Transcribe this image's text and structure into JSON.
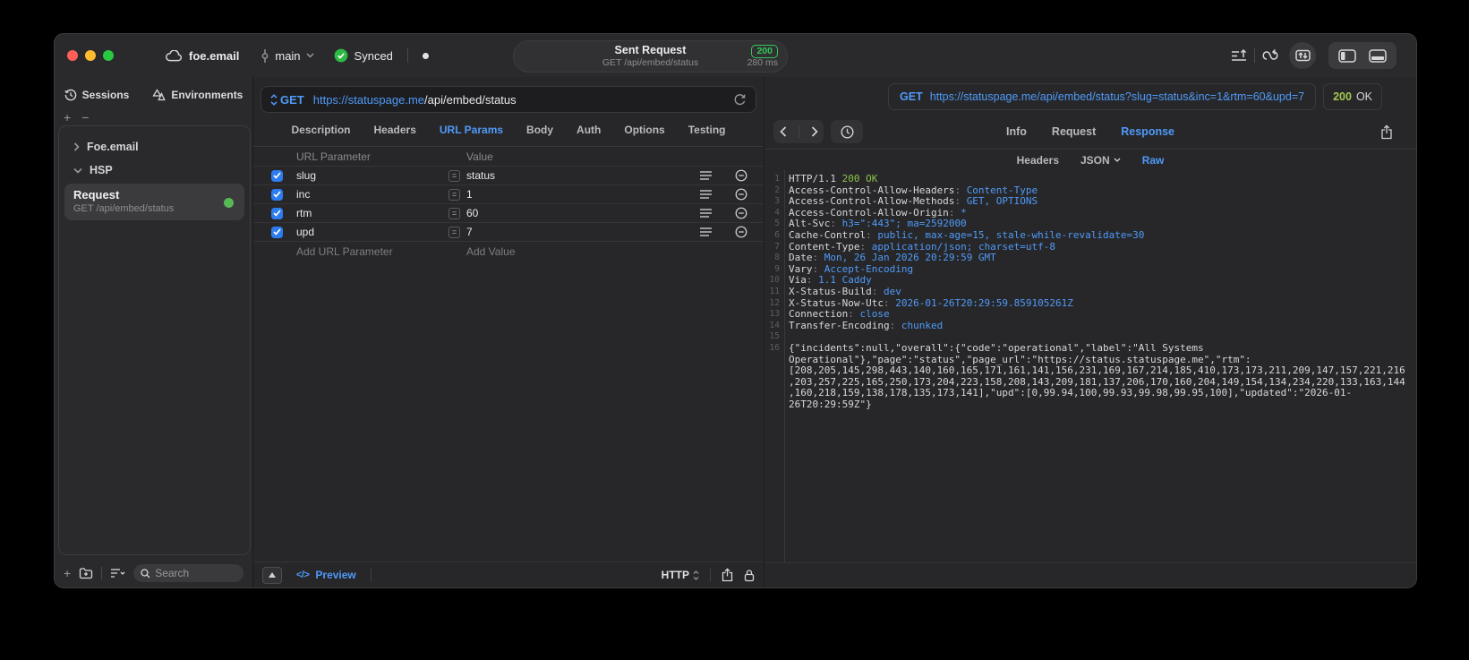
{
  "titlebar": {
    "project": "foe.email",
    "branch": "main",
    "sync_label": "Synced",
    "center": {
      "title": "Sent Request",
      "status_code": "200",
      "subtitle": "GET /api/embed/status",
      "duration": "280 ms"
    }
  },
  "sidebar": {
    "tabs": [
      "Sessions",
      "Environments"
    ],
    "tree": [
      {
        "label": "Foe.email",
        "state": "collapsed"
      },
      {
        "label": "HSP",
        "state": "expanded"
      }
    ],
    "request_item": {
      "title": "Request",
      "subtitle": "GET /api/embed/status"
    },
    "search_placeholder": "Search"
  },
  "request_pane": {
    "method": "GET",
    "url_host": "https://statuspage.me",
    "url_path": "/api/embed/status",
    "tabs": [
      "Description",
      "Headers",
      "URL Params",
      "Body",
      "Auth",
      "Options",
      "Testing"
    ],
    "active_tab": "URL Params",
    "params_table": {
      "columns": [
        "URL Parameter",
        "Value"
      ],
      "eq_symbol": "=",
      "rows": [
        {
          "name": "slug",
          "value": "status",
          "enabled": true
        },
        {
          "name": "inc",
          "value": "1",
          "enabled": true
        },
        {
          "name": "rtm",
          "value": "60",
          "enabled": true
        },
        {
          "name": "upd",
          "value": "7",
          "enabled": true
        }
      ],
      "add_name_placeholder": "Add URL Parameter",
      "add_value_placeholder": "Add Value"
    },
    "footer": {
      "preview_icon": "</>",
      "preview_label": "Preview",
      "protocol": "HTTP"
    }
  },
  "response_pane": {
    "request_line": {
      "method": "GET",
      "url": "https://statuspage.me/api/embed/status?slug=status&inc=1&rtm=60&upd=7"
    },
    "status": {
      "code": "200",
      "text": "OK"
    },
    "tabs": [
      "Info",
      "Request",
      "Response"
    ],
    "active_tab": "Response",
    "subtabs": [
      "Headers",
      "JSON",
      "Raw"
    ],
    "active_subtab": "Raw",
    "code": {
      "status_protocol": "HTTP/1.1",
      "status_text": "200 OK",
      "headers": [
        {
          "name": "Access-Control-Allow-Headers",
          "value": "Content-Type"
        },
        {
          "name": "Access-Control-Allow-Methods",
          "value": "GET, OPTIONS"
        },
        {
          "name": "Access-Control-Allow-Origin",
          "value": "*"
        },
        {
          "name": "Alt-Svc",
          "value": "h3=\":443\"; ma=2592000"
        },
        {
          "name": "Cache-Control",
          "value": "public, max-age=15, stale-while-revalidate=30"
        },
        {
          "name": "Content-Type",
          "value": "application/json; charset=utf-8"
        },
        {
          "name": "Date",
          "value": "Mon, 26 Jan 2026 20:29:59 GMT"
        },
        {
          "name": "Vary",
          "value": "Accept-Encoding"
        },
        {
          "name": "Via",
          "value": "1.1 Caddy"
        },
        {
          "name": "X-Status-Build",
          "value": "dev"
        },
        {
          "name": "X-Status-Now-Utc",
          "value": "2026-01-26T20:29:59.859105261Z"
        },
        {
          "name": "Connection",
          "value": "close"
        },
        {
          "name": "Transfer-Encoding",
          "value": "chunked"
        }
      ],
      "body": "{\"incidents\":null,\"overall\":{\"code\":\"operational\",\"label\":\"All Systems Operational\"},\"page\":\"status\",\"page_url\":\"https://status.statuspage.me\",\"rtm\":[208,205,145,298,443,140,160,165,171,161,141,156,231,169,167,214,185,410,173,173,211,209,147,157,221,216,203,257,225,165,250,173,204,223,158,208,143,209,181,137,206,170,160,204,149,154,134,234,220,133,163,144,160,218,159,138,178,135,173,141],\"upd\":[0,99.94,100,99.93,99.98,99.95,100],\"updated\":\"2026-01-26T20:29:59Z\"}"
    }
  },
  "colors": {
    "accent_blue": "#4f9af8",
    "badge_green": "#32c759",
    "code_green": "#8bc34a",
    "checkbox_blue": "#2d7cf0",
    "status_dot_green": "#57b956"
  }
}
